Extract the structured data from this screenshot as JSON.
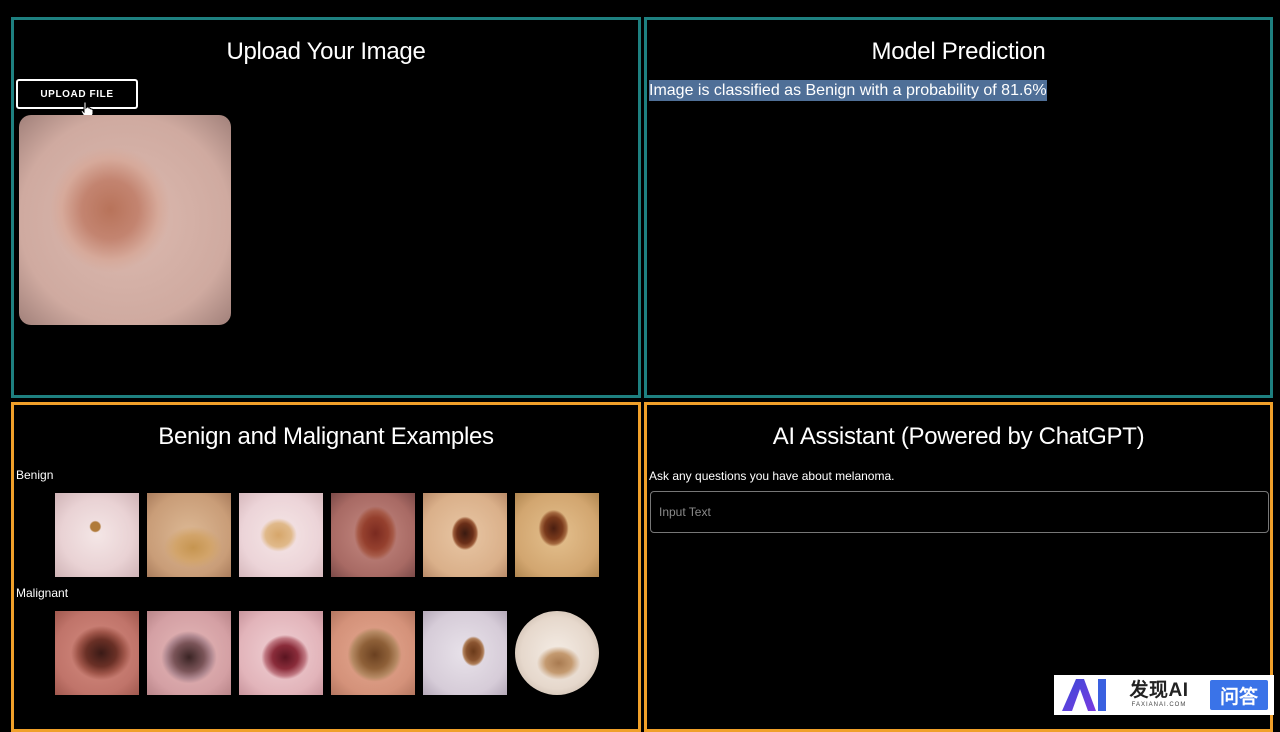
{
  "upload_panel": {
    "title": "Upload Your Image",
    "button_label": "UPLOAD FILE"
  },
  "prediction_panel": {
    "title": "Model Prediction",
    "result_text": "Image is classified as Benign with a probability of 81.6%"
  },
  "examples_panel": {
    "title": "Benign and Malignant Examples",
    "benign_label": "Benign",
    "malignant_label": "Malignant"
  },
  "assistant_panel": {
    "title": "AI Assistant (Powered by ChatGPT)",
    "description": "Ask any questions you have about melanoma.",
    "input_placeholder": "Input Text"
  },
  "watermark": {
    "main": "发现AI",
    "sub": "FAXIANAI.COM",
    "badge": "问答"
  },
  "colors": {
    "teal_border": "#1e8080",
    "orange_border": "#f0a02a",
    "highlight": "#4f6f97"
  }
}
